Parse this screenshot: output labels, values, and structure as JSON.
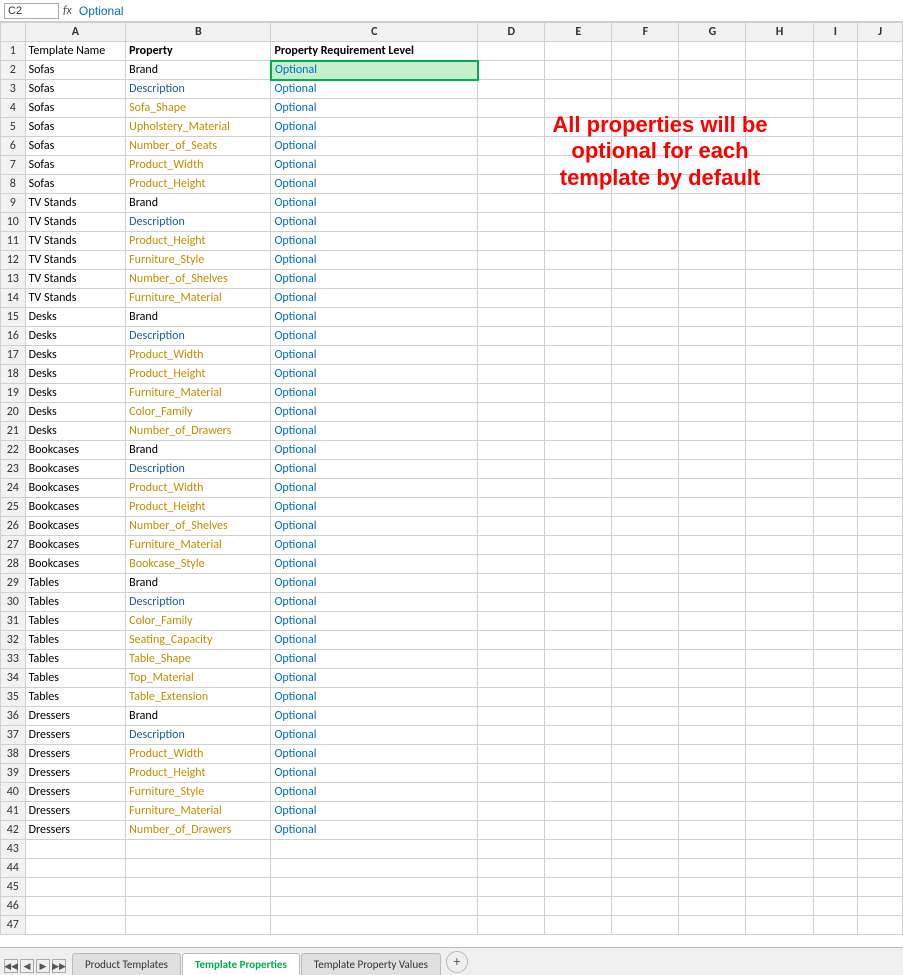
{
  "formula_bar": {
    "cell_ref": "C2",
    "formula": "Optional"
  },
  "columns": {
    "row_num": "#",
    "headers": [
      "",
      "A",
      "B",
      "C",
      "D",
      "E",
      "F",
      "G",
      "H",
      "I",
      "J"
    ]
  },
  "rows": [
    {
      "row": 1,
      "A": "Template Name",
      "B": "Property",
      "C": "Property Requirement Level",
      "D": "",
      "E": "",
      "F": "",
      "G": "",
      "H": "",
      "I": "",
      "J": "",
      "type": "header"
    },
    {
      "row": 2,
      "A": "Sofas",
      "B": "Brand",
      "C": "Optional",
      "D": "",
      "E": "",
      "F": "",
      "G": "",
      "H": "",
      "I": "",
      "J": "",
      "type": "data",
      "B_color": "normal",
      "selected_C": true
    },
    {
      "row": 3,
      "A": "Sofas",
      "B": "Description",
      "C": "Optional",
      "B_color": "blue"
    },
    {
      "row": 4,
      "A": "Sofas",
      "B": "Sofa_Shape",
      "C": "Optional",
      "B_color": "orange"
    },
    {
      "row": 5,
      "A": "Sofas",
      "B": "Upholstery_Material",
      "C": "Optional",
      "B_color": "orange"
    },
    {
      "row": 6,
      "A": "Sofas",
      "B": "Number_of_Seats",
      "C": "Optional",
      "B_color": "orange"
    },
    {
      "row": 7,
      "A": "Sofas",
      "B": "Product_Width",
      "C": "Optional",
      "B_color": "orange"
    },
    {
      "row": 8,
      "A": "Sofas",
      "B": "Product_Height",
      "C": "Optional",
      "B_color": "orange"
    },
    {
      "row": 9,
      "A": "TV Stands",
      "B": "Brand",
      "C": "Optional",
      "B_color": "normal"
    },
    {
      "row": 10,
      "A": "TV Stands",
      "B": "Description",
      "C": "Optional",
      "B_color": "blue"
    },
    {
      "row": 11,
      "A": "TV Stands",
      "B": "Product_Height",
      "C": "Optional",
      "B_color": "orange"
    },
    {
      "row": 12,
      "A": "TV Stands",
      "B": "Furniture_Style",
      "C": "Optional",
      "B_color": "orange"
    },
    {
      "row": 13,
      "A": "TV Stands",
      "B": "Number_of_Shelves",
      "C": "Optional",
      "B_color": "orange"
    },
    {
      "row": 14,
      "A": "TV Stands",
      "B": "Furniture_Material",
      "C": "Optional",
      "B_color": "orange"
    },
    {
      "row": 15,
      "A": "Desks",
      "B": "Brand",
      "C": "Optional",
      "B_color": "normal"
    },
    {
      "row": 16,
      "A": "Desks",
      "B": "Description",
      "C": "Optional",
      "B_color": "blue"
    },
    {
      "row": 17,
      "A": "Desks",
      "B": "Product_Width",
      "C": "Optional",
      "B_color": "orange"
    },
    {
      "row": 18,
      "A": "Desks",
      "B": "Product_Height",
      "C": "Optional",
      "B_color": "orange"
    },
    {
      "row": 19,
      "A": "Desks",
      "B": "Furniture_Material",
      "C": "Optional",
      "B_color": "orange"
    },
    {
      "row": 20,
      "A": "Desks",
      "B": "Color_Family",
      "C": "Optional",
      "B_color": "orange"
    },
    {
      "row": 21,
      "A": "Desks",
      "B": "Number_of_Drawers",
      "C": "Optional",
      "B_color": "orange"
    },
    {
      "row": 22,
      "A": "Bookcases",
      "B": "Brand",
      "C": "Optional",
      "B_color": "normal"
    },
    {
      "row": 23,
      "A": "Bookcases",
      "B": "Description",
      "C": "Optional",
      "B_color": "blue"
    },
    {
      "row": 24,
      "A": "Bookcases",
      "B": "Product_Width",
      "C": "Optional",
      "B_color": "orange"
    },
    {
      "row": 25,
      "A": "Bookcases",
      "B": "Product_Height",
      "C": "Optional",
      "B_color": "orange"
    },
    {
      "row": 26,
      "A": "Bookcases",
      "B": "Number_of_Shelves",
      "C": "Optional",
      "B_color": "orange"
    },
    {
      "row": 27,
      "A": "Bookcases",
      "B": "Furniture_Material",
      "C": "Optional",
      "B_color": "orange"
    },
    {
      "row": 28,
      "A": "Bookcases",
      "B": "Bookcase_Style",
      "C": "Optional",
      "B_color": "orange"
    },
    {
      "row": 29,
      "A": "Tables",
      "B": "Brand",
      "C": "Optional",
      "B_color": "normal"
    },
    {
      "row": 30,
      "A": "Tables",
      "B": "Description",
      "C": "Optional",
      "B_color": "blue"
    },
    {
      "row": 31,
      "A": "Tables",
      "B": "Color_Family",
      "C": "Optional",
      "B_color": "orange"
    },
    {
      "row": 32,
      "A": "Tables",
      "B": "Seating_Capacity",
      "C": "Optional",
      "B_color": "orange"
    },
    {
      "row": 33,
      "A": "Tables",
      "B": "Table_Shape",
      "C": "Optional",
      "B_color": "orange"
    },
    {
      "row": 34,
      "A": "Tables",
      "B": "Top_Material",
      "C": "Optional",
      "B_color": "orange"
    },
    {
      "row": 35,
      "A": "Tables",
      "B": "Table_Extension",
      "C": "Optional",
      "B_color": "orange"
    },
    {
      "row": 36,
      "A": "Dressers",
      "B": "Brand",
      "C": "Optional",
      "B_color": "normal"
    },
    {
      "row": 37,
      "A": "Dressers",
      "B": "Description",
      "C": "Optional",
      "B_color": "blue"
    },
    {
      "row": 38,
      "A": "Dressers",
      "B": "Product_Width",
      "C": "Optional",
      "B_color": "orange"
    },
    {
      "row": 39,
      "A": "Dressers",
      "B": "Product_Height",
      "C": "Optional",
      "B_color": "orange"
    },
    {
      "row": 40,
      "A": "Dressers",
      "B": "Furniture_Style",
      "C": "Optional",
      "B_color": "orange"
    },
    {
      "row": 41,
      "A": "Dressers",
      "B": "Furniture_Material",
      "C": "Optional",
      "B_color": "orange"
    },
    {
      "row": 42,
      "A": "Dressers",
      "B": "Number_of_Drawers",
      "C": "Optional",
      "B_color": "orange"
    },
    {
      "row": 43,
      "A": "",
      "B": "",
      "C": "",
      "B_color": "normal"
    },
    {
      "row": 44,
      "A": "",
      "B": "",
      "C": "",
      "B_color": "normal"
    },
    {
      "row": 45,
      "A": "",
      "B": "",
      "C": "",
      "B_color": "normal"
    },
    {
      "row": 46,
      "A": "",
      "B": "",
      "C": "",
      "B_color": "normal"
    },
    {
      "row": 47,
      "A": "",
      "B": "",
      "C": "",
      "B_color": "normal"
    }
  ],
  "annotation": {
    "line1": "All properties will be",
    "line2": "optional for each",
    "line3": "template by default"
  },
  "tabs": [
    {
      "label": "Product Templates",
      "active": false
    },
    {
      "label": "Template Properties",
      "active": true
    },
    {
      "label": "Template Property Values",
      "active": false
    }
  ],
  "tab_add_label": "+"
}
